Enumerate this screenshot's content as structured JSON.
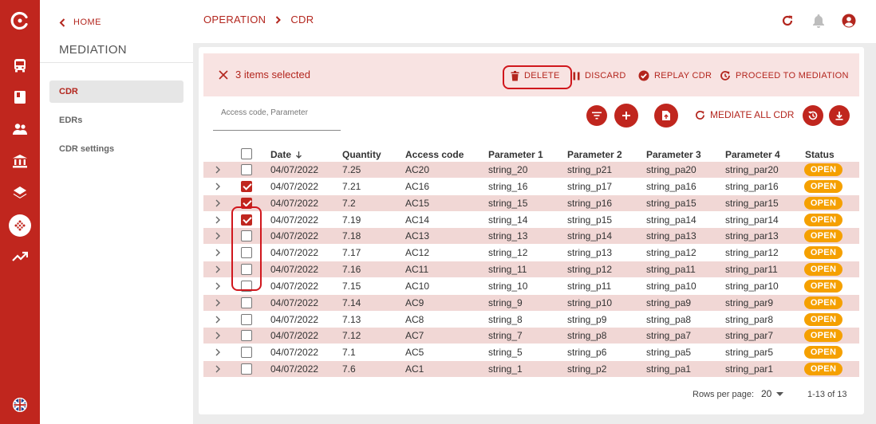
{
  "rail": {
    "icons": [
      "brand-logo-icon",
      "bus-icon",
      "book-icon",
      "users-icon",
      "bank-icon",
      "layers-icon",
      "mediation-icon",
      "trending-up-icon",
      "language-flag-icon"
    ]
  },
  "sidebar": {
    "home_label": "HOME",
    "section_title": "MEDIATION",
    "items": [
      {
        "label": "CDR",
        "active": true
      },
      {
        "label": "EDRs",
        "active": false
      },
      {
        "label": "CDR settings",
        "active": false
      }
    ]
  },
  "header": {
    "breadcrumb": [
      "OPERATION",
      "CDR"
    ]
  },
  "selection": {
    "count_text": "3 items selected",
    "actions": {
      "delete": "DELETE",
      "discard": "DISCARD",
      "replay": "REPLAY CDR",
      "proceed": "PROCEED TO MEDIATION"
    }
  },
  "search": {
    "placeholder": "Access code, Parameter",
    "value": ""
  },
  "toolbar": {
    "mediate_all": "MEDIATE ALL CDR"
  },
  "table": {
    "columns": [
      "Date",
      "Quantity",
      "Access code",
      "Parameter 1",
      "Parameter 2",
      "Parameter 3",
      "Parameter 4",
      "Status"
    ],
    "sort_column": "Date",
    "rows": [
      {
        "date": "04/07/2022",
        "quantity": "7.25",
        "access_code": "AC20",
        "p1": "string_20",
        "p2": "string_p21",
        "p3": "string_pa20",
        "p4": "string_par20",
        "status": "OPEN",
        "checked": false
      },
      {
        "date": "04/07/2022",
        "quantity": "7.21",
        "access_code": "AC16",
        "p1": "string_16",
        "p2": "string_p17",
        "p3": "string_pa16",
        "p4": "string_par16",
        "status": "OPEN",
        "checked": true
      },
      {
        "date": "04/07/2022",
        "quantity": "7.2",
        "access_code": "AC15",
        "p1": "string_15",
        "p2": "string_p16",
        "p3": "string_pa15",
        "p4": "string_par15",
        "status": "OPEN",
        "checked": true
      },
      {
        "date": "04/07/2022",
        "quantity": "7.19",
        "access_code": "AC14",
        "p1": "string_14",
        "p2": "string_p15",
        "p3": "string_pa14",
        "p4": "string_par14",
        "status": "OPEN",
        "checked": true
      },
      {
        "date": "04/07/2022",
        "quantity": "7.18",
        "access_code": "AC13",
        "p1": "string_13",
        "p2": "string_p14",
        "p3": "string_pa13",
        "p4": "string_par13",
        "status": "OPEN",
        "checked": false
      },
      {
        "date": "04/07/2022",
        "quantity": "7.17",
        "access_code": "AC12",
        "p1": "string_12",
        "p2": "string_p13",
        "p3": "string_pa12",
        "p4": "string_par12",
        "status": "OPEN",
        "checked": false
      },
      {
        "date": "04/07/2022",
        "quantity": "7.16",
        "access_code": "AC11",
        "p1": "string_11",
        "p2": "string_p12",
        "p3": "string_pa11",
        "p4": "string_par11",
        "status": "OPEN",
        "checked": false
      },
      {
        "date": "04/07/2022",
        "quantity": "7.15",
        "access_code": "AC10",
        "p1": "string_10",
        "p2": "string_p11",
        "p3": "string_pa10",
        "p4": "string_par10",
        "status": "OPEN",
        "checked": false
      },
      {
        "date": "04/07/2022",
        "quantity": "7.14",
        "access_code": "AC9",
        "p1": "string_9",
        "p2": "string_p10",
        "p3": "string_pa9",
        "p4": "string_par9",
        "status": "OPEN",
        "checked": false
      },
      {
        "date": "04/07/2022",
        "quantity": "7.13",
        "access_code": "AC8",
        "p1": "string_8",
        "p2": "string_p9",
        "p3": "string_pa8",
        "p4": "string_par8",
        "status": "OPEN",
        "checked": false
      },
      {
        "date": "04/07/2022",
        "quantity": "7.12",
        "access_code": "AC7",
        "p1": "string_7",
        "p2": "string_p8",
        "p3": "string_pa7",
        "p4": "string_par7",
        "status": "OPEN",
        "checked": false
      },
      {
        "date": "04/07/2022",
        "quantity": "7.1",
        "access_code": "AC5",
        "p1": "string_5",
        "p2": "string_p6",
        "p3": "string_pa5",
        "p4": "string_par5",
        "status": "OPEN",
        "checked": false
      },
      {
        "date": "04/07/2022",
        "quantity": "7.6",
        "access_code": "AC1",
        "p1": "string_1",
        "p2": "string_p2",
        "p3": "string_pa1",
        "p4": "string_par1",
        "status": "OPEN",
        "checked": false
      }
    ]
  },
  "pagination": {
    "rows_per_page_label": "Rows per page:",
    "rows_per_page": "20",
    "range": "1-13 of 13"
  },
  "colors": {
    "brand": "#c0261e",
    "row_tint": "#f1d7d5",
    "status_open": "#f5a000",
    "highlight": "#d0171d"
  }
}
